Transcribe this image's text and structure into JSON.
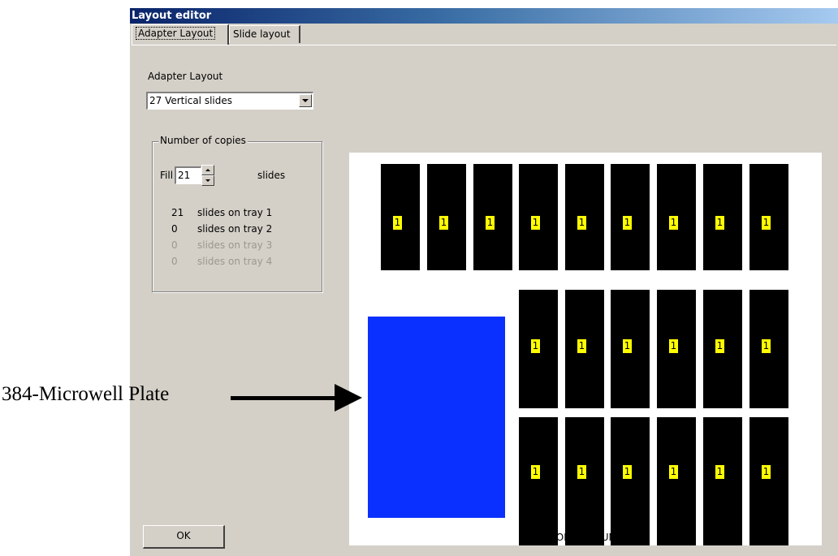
{
  "window": {
    "title": "Layout editor"
  },
  "tabs": [
    {
      "label": "Adapter Layout"
    },
    {
      "label": "Slide layout"
    }
  ],
  "adapter": {
    "label": "Adapter Layout",
    "selected": "27 Vertical slides"
  },
  "copies": {
    "group_label": "Number of copies",
    "fill_label": "Fill",
    "fill_value": "21",
    "unit_label": "slides",
    "trays": [
      {
        "count": "21",
        "label": "slides on tray 1"
      },
      {
        "count": "0",
        "label": "slides on tray 2"
      },
      {
        "count": "0",
        "label": "slides on tray 3"
      },
      {
        "count": "0",
        "label": "slides on tray 4"
      }
    ]
  },
  "ok_label": "OK",
  "canvas": {
    "slide_number": "1",
    "front_label": "FRONT OF INSTRUMENT",
    "plate_color": "#0a30ff",
    "badge_color": "#ffff00"
  },
  "annotation": {
    "label": "384-Microwell Plate"
  }
}
